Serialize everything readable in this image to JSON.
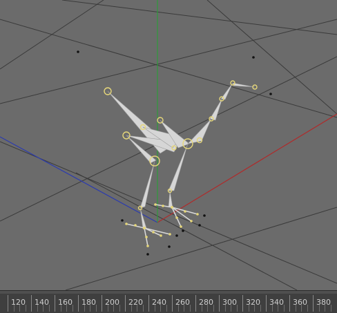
{
  "viewport": {
    "background": "#6b6b6b",
    "grid_color": "#3c3c3c",
    "axis_x_color": "#b02a2a",
    "axis_y_color": "#2e9a3a",
    "axis_z_color": "#2a3ab0",
    "bone_color": "#d8d8d8",
    "joint_color": "#e6d77a"
  },
  "timeline": {
    "frame_labels": [
      "120",
      "140",
      "160",
      "180",
      "200",
      "220",
      "240",
      "260",
      "280",
      "300",
      "320",
      "340",
      "360",
      "380"
    ]
  }
}
